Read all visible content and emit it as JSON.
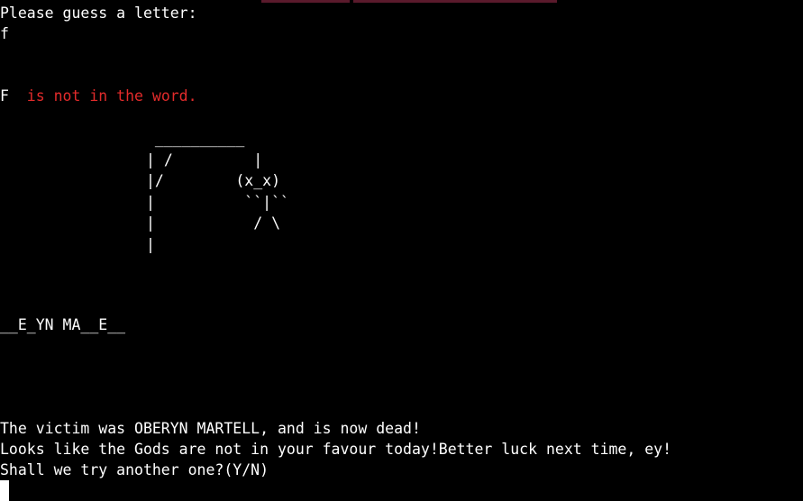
{
  "terminal": {
    "prompt": "Please guess a letter:",
    "input": "f",
    "feedback_letter": "F",
    "feedback_message": "  is not in the word.",
    "gallows_art": " __________\n| /         |\n|/        (x_x)\n|          ``|``\n|           / \\\n|",
    "word_progress": "__E_YN MA__E__",
    "result_line": "The victim was OBERYN MARTELL, and is now dead!",
    "taunt_line": "Looks like the Gods are not in your favour today!Better luck next time, ey!",
    "replay_prompt": "Shall we try another one?(Y/N)"
  },
  "colors": {
    "background": "#000000",
    "text": "#ffffff",
    "error": "#e22b2b",
    "top_bar": "#5a1a2c"
  }
}
